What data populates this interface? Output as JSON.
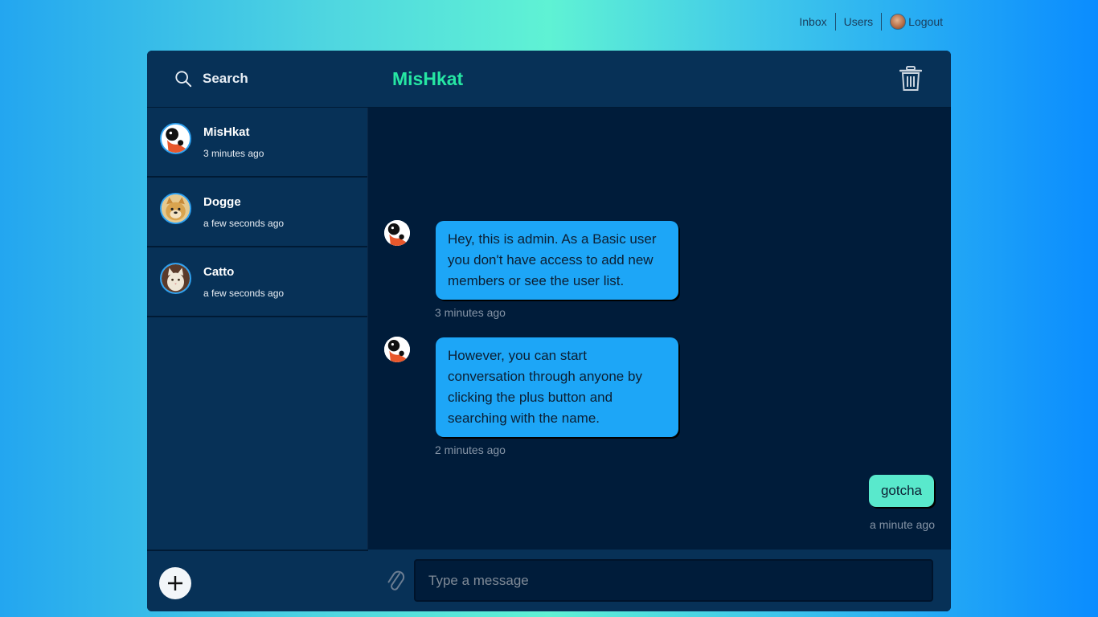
{
  "topnav": {
    "inbox": "Inbox",
    "users": "Users",
    "logout": "Logout"
  },
  "search": {
    "label": "Search",
    "icon": "search-icon"
  },
  "chat": {
    "title": "MisHkat",
    "delete_icon": "trash-icon"
  },
  "conversations": [
    {
      "name": "MisHkat",
      "time": "3 minutes ago",
      "avatar": "avatar-mishkat"
    },
    {
      "name": "Dogge",
      "time": "a few seconds ago",
      "avatar": "avatar-dogge"
    },
    {
      "name": "Catto",
      "time": "a few seconds ago",
      "avatar": "avatar-catto"
    }
  ],
  "messages": [
    {
      "text": "Hey, this is admin. As a Basic user you don't have access to add new members or see the user list.",
      "time": "3 minutes ago",
      "from": "other"
    },
    {
      "text": "However, you can start conversation through anyone by clicking the plus button and searching with the name.",
      "time": "2 minutes ago",
      "from": "other"
    },
    {
      "text": "gotcha",
      "time": "a minute ago",
      "from": "me"
    }
  ],
  "compose": {
    "placeholder": "Type a message",
    "attach_icon": "paperclip-icon",
    "add_icon": "plus-icon"
  },
  "colors": {
    "accent": "#26e6a3",
    "bubble_other": "#1da6f7",
    "bubble_me": "#59e9cc",
    "panel": "#073157",
    "background": "#001c3a"
  }
}
